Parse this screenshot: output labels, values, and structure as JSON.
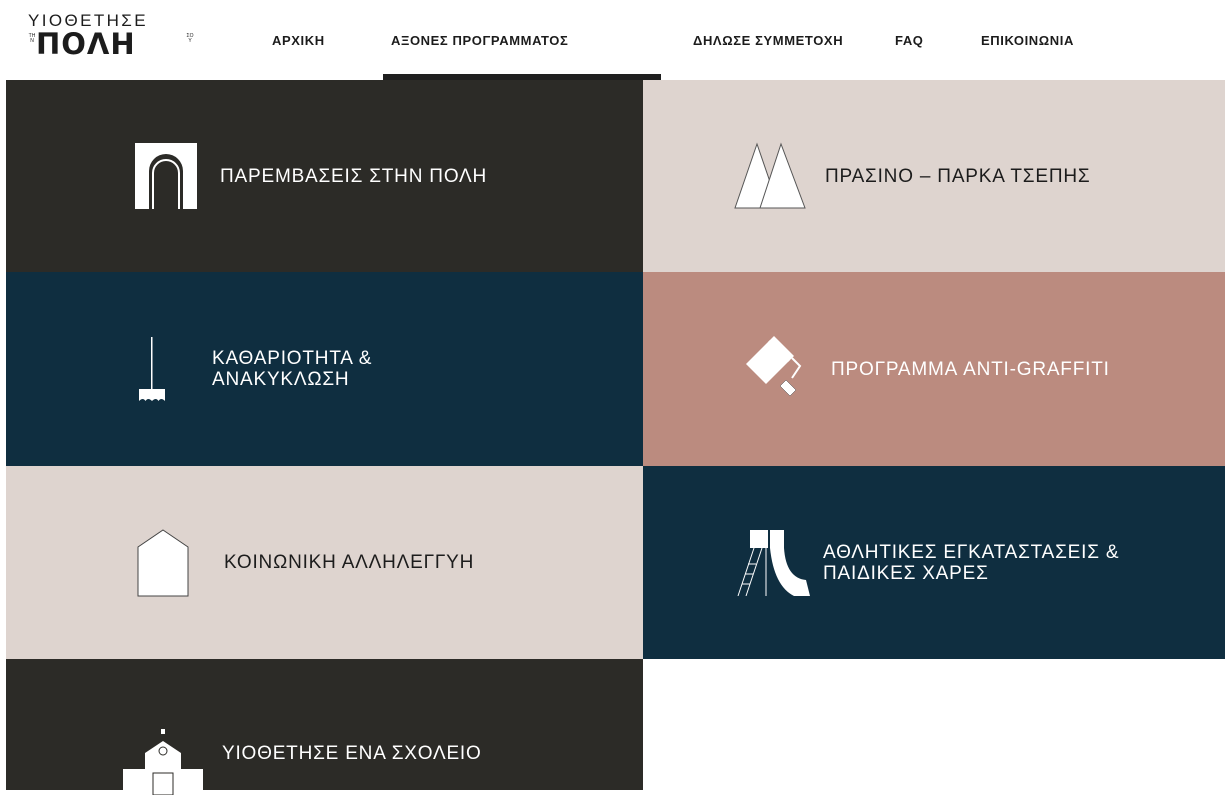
{
  "logo": {
    "top": "ΥΙΟΘΕΤΗΣΕ",
    "small_left": "ΤΗΝ",
    "main": "ΠΟΛΗ",
    "small_right": "ΣΟΥ"
  },
  "nav": {
    "items": [
      {
        "label": "ΑΡΧΙΚΗ"
      },
      {
        "label": "ΑΞΟΝΕΣ ΠΡΟΓΡΑΜΜΑΤΟΣ",
        "active": true
      },
      {
        "label": "ΔΗΛΩΣΕ ΣΥΜΜΕΤΟΧΗ"
      },
      {
        "label": "FAQ"
      },
      {
        "label": "ΕΠΙΚΟΙΝΩΝΙΑ"
      }
    ]
  },
  "tiles": [
    {
      "label": "ΠΑΡΕΜΒΑΣΕΙΣ ΣΤΗΝ ΠΟΛΗ",
      "icon": "arch-icon",
      "color": "#2c2b27"
    },
    {
      "label": "ΠΡΑΣΙΝΟ – ΠΑΡΚΑ ΤΣΕΠΗΣ",
      "icon": "trees-icon",
      "color": "#ded4cf"
    },
    {
      "label": "ΚΑΘΑΡΙΟΤΗΤΑ &\nΑΝΑΚΥΚΛΩΣΗ",
      "icon": "broom-icon",
      "color": "#0f2e40"
    },
    {
      "label": "ΠΡΟΓΡΑΜΜΑ ANTI-GRAFFITI",
      "icon": "paint-roller-icon",
      "color": "#bb8b7f"
    },
    {
      "label": "ΚΟΙΝΩΝΙΚΗ ΑΛΛΗΛΕΓΓΥΗ",
      "icon": "house-icon",
      "color": "#ded4cf"
    },
    {
      "label": "ΑΘΛΗΤΙΚΕΣ ΕΓΚΑΤΑΣΤΑΣΕΙΣ &\nΠΑΙΔΙΚΕΣ ΧΑΡΕΣ",
      "icon": "slide-icon",
      "color": "#0f2e40"
    },
    {
      "label": "ΥΙΟΘΕΤΗΣΕ ΕΝΑ ΣΧΟΛΕΙΟ",
      "icon": "school-icon",
      "color": "#2c2b27"
    }
  ]
}
